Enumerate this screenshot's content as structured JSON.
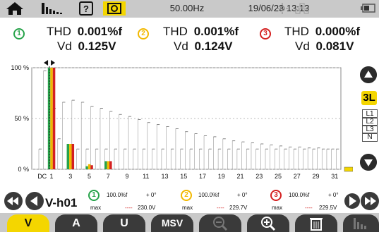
{
  "topbar": {
    "frequency": "50.00Hz",
    "datetime": "19/06/23 13:13"
  },
  "header": {
    "phases": [
      {
        "num": "1",
        "color": "#27a34a",
        "thd_label": "THD",
        "thd_value": "0.001%f",
        "vd_label": "Vd",
        "vd_value": "0.125V"
      },
      {
        "num": "2",
        "color": "#f2b800",
        "thd_label": "THD",
        "thd_value": "0.001%f",
        "vd_label": "Vd",
        "vd_value": "0.124V"
      },
      {
        "num": "3",
        "color": "#d42020",
        "thd_label": "THD",
        "thd_value": "0.000%f",
        "vd_label": "Vd",
        "vd_value": "0.081V"
      }
    ]
  },
  "chart_data": {
    "type": "bar",
    "ylabel_ticks": [
      "100 %",
      "50 %",
      "0 %"
    ],
    "yticks": [
      100,
      50,
      0
    ],
    "ylim": [
      0,
      100
    ],
    "x_tick_labels": [
      "DC",
      "1",
      "3",
      "5",
      "7",
      "9",
      "11",
      "13",
      "15",
      "17",
      "19",
      "21",
      "23",
      "25",
      "27",
      "29",
      "31"
    ],
    "harmonic_count": 32,
    "series": [
      {
        "name": "L1",
        "color": "#27a34a",
        "values": {
          "1": 100,
          "3": 25,
          "5": 3,
          "7": 8
        }
      },
      {
        "name": "L2",
        "color": "#f2b800",
        "values": {
          "1": 100,
          "3": 25,
          "5": 5,
          "7": 8
        }
      },
      {
        "name": "L3",
        "color": "#d42020",
        "values": {
          "1": 100,
          "3": 25,
          "5": 4,
          "7": 8
        }
      }
    ],
    "max_markers": [
      20,
      97,
      20,
      60,
      30,
      66,
      20,
      68,
      20,
      66,
      20,
      62,
      20,
      60,
      20,
      57,
      20,
      54,
      20,
      52,
      20,
      49,
      20,
      46,
      20,
      44,
      20,
      42,
      20,
      40,
      20,
      37,
      20,
      35,
      20,
      33,
      20,
      32,
      20,
      30,
      20,
      28,
      20,
      27,
      20,
      26,
      20,
      25,
      20,
      24,
      20,
      23,
      20,
      22,
      20,
      22,
      20,
      21,
      20,
      21,
      20,
      20,
      20,
      20
    ]
  },
  "side": {
    "selected": "3L",
    "phases": [
      "L1",
      "L2",
      "L3",
      "N"
    ]
  },
  "info": {
    "harmonic_label": "V-h01",
    "phases": [
      {
        "num": "1",
        "color": "#27a34a",
        "percent": "100.0%f",
        "angle": "+ 0°",
        "max_label": "max",
        "dash": "----",
        "value": "230.0V"
      },
      {
        "num": "2",
        "color": "#f2b800",
        "percent": "100.0%f",
        "angle": "+ 0°",
        "max_label": "max",
        "dash": "----",
        "value": "229.7V"
      },
      {
        "num": "3",
        "color": "#d42020",
        "percent": "100.0%f",
        "angle": "+ 0°",
        "max_label": "max",
        "dash": "----",
        "value": "229.5V"
      }
    ]
  },
  "tabs": [
    {
      "label": "V",
      "active": true
    },
    {
      "label": "A",
      "active": false
    },
    {
      "label": "U",
      "active": false
    },
    {
      "label": "MSV",
      "active": false
    },
    {
      "label": "zoom-out",
      "active": false
    },
    {
      "label": "zoom-in",
      "active": false
    },
    {
      "label": "trash",
      "active": false
    },
    {
      "label": "histogram",
      "active": false
    }
  ]
}
